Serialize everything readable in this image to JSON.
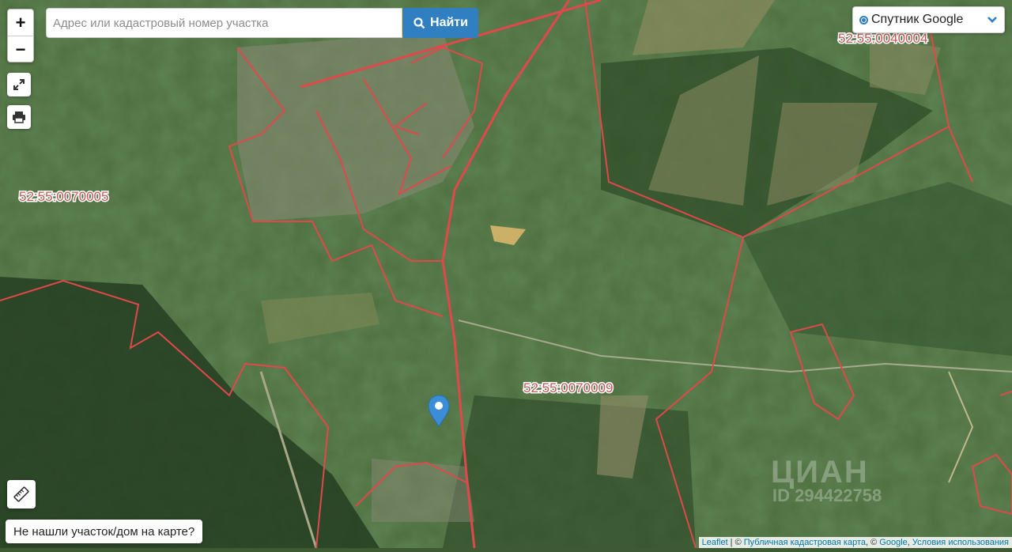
{
  "search": {
    "placeholder": "Адрес или кадастровый номер участка",
    "button_label": "Найти"
  },
  "zoom": {
    "in_label": "+",
    "out_label": "−"
  },
  "layer_select": {
    "selected": "Спутник Google"
  },
  "cadastral_labels": [
    "52:55:0040004",
    "52:55:0070005",
    "52:55:0070009"
  ],
  "not_found_label": "Не нашли участок/дом на карте?",
  "attribution": {
    "leaflet": "Leaflet",
    "sep1": " | © ",
    "pkk": "Публичная кадастровая карта",
    "sep2": ", © ",
    "google": "Google",
    "sep3": ", ",
    "terms": "Условия использования"
  },
  "watermark": {
    "brand": "ЦИАН",
    "id": "ID 294422758"
  },
  "colors": {
    "boundary": "#e0484b",
    "accent": "#2f7fc1",
    "label": "#c25a5a",
    "marker": "#3a8dd6"
  },
  "icons": [
    "fullscreen-icon",
    "print-icon",
    "ruler-icon",
    "search-icon",
    "chevron-down-icon",
    "map-marker-icon"
  ]
}
